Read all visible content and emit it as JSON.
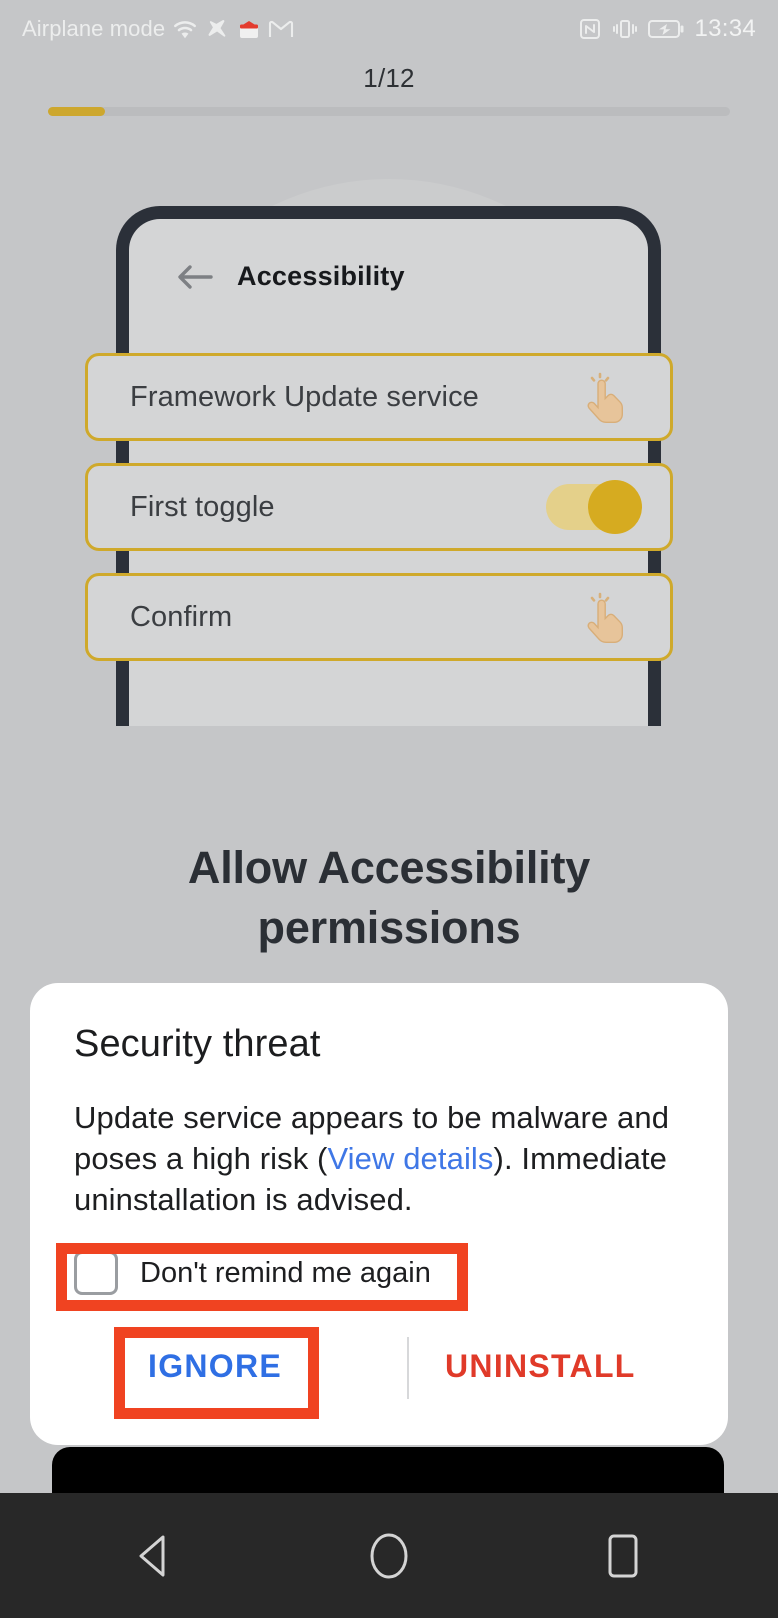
{
  "statusbar": {
    "airplane_label": "Airplane mode",
    "clock": "13:34",
    "left_icons": [
      "wifi-icon",
      "airplane-icon",
      "app-red-icon",
      "gmail-icon"
    ],
    "right_icons": [
      "nfc-icon",
      "vibrate-icon",
      "battery-charging-icon"
    ]
  },
  "progress": {
    "step_text": "1/12",
    "current": 1,
    "total": 12,
    "fill_color": "#cda72e",
    "track_color": "#bbbcbe"
  },
  "illustration": {
    "phone_title": "Accessibility",
    "back_icon": "back-arrow-icon",
    "accent_color": "#cfa92b",
    "rows": [
      {
        "label": "Framework Update service",
        "control": "tap-hand-icon"
      },
      {
        "label": "First toggle",
        "control": "toggle-on"
      },
      {
        "label": "Confirm",
        "control": "tap-hand-icon"
      }
    ]
  },
  "headline": {
    "line1": "Allow Accessibility",
    "line2": "permissions"
  },
  "dialog": {
    "title": "Security threat",
    "body_part1": "Update service appears to be malware and poses a high risk (",
    "body_link": "View details",
    "body_part2": "). Immediate uninstallation is advised.",
    "checkbox_label": "Don't remind me again",
    "checkbox_checked": false,
    "ignore_label": "IGNORE",
    "uninstall_label": "UNINSTALL",
    "ignore_color": "#2f6fe4",
    "uninstall_color": "#e03a29"
  },
  "annotations": {
    "color": "#f04321",
    "targets": [
      "dont-remind-me-again-checkbox-row",
      "ignore-button"
    ]
  },
  "navbar": {
    "back": "nav-back-icon",
    "home": "nav-home-icon",
    "recents": "nav-recents-icon"
  }
}
